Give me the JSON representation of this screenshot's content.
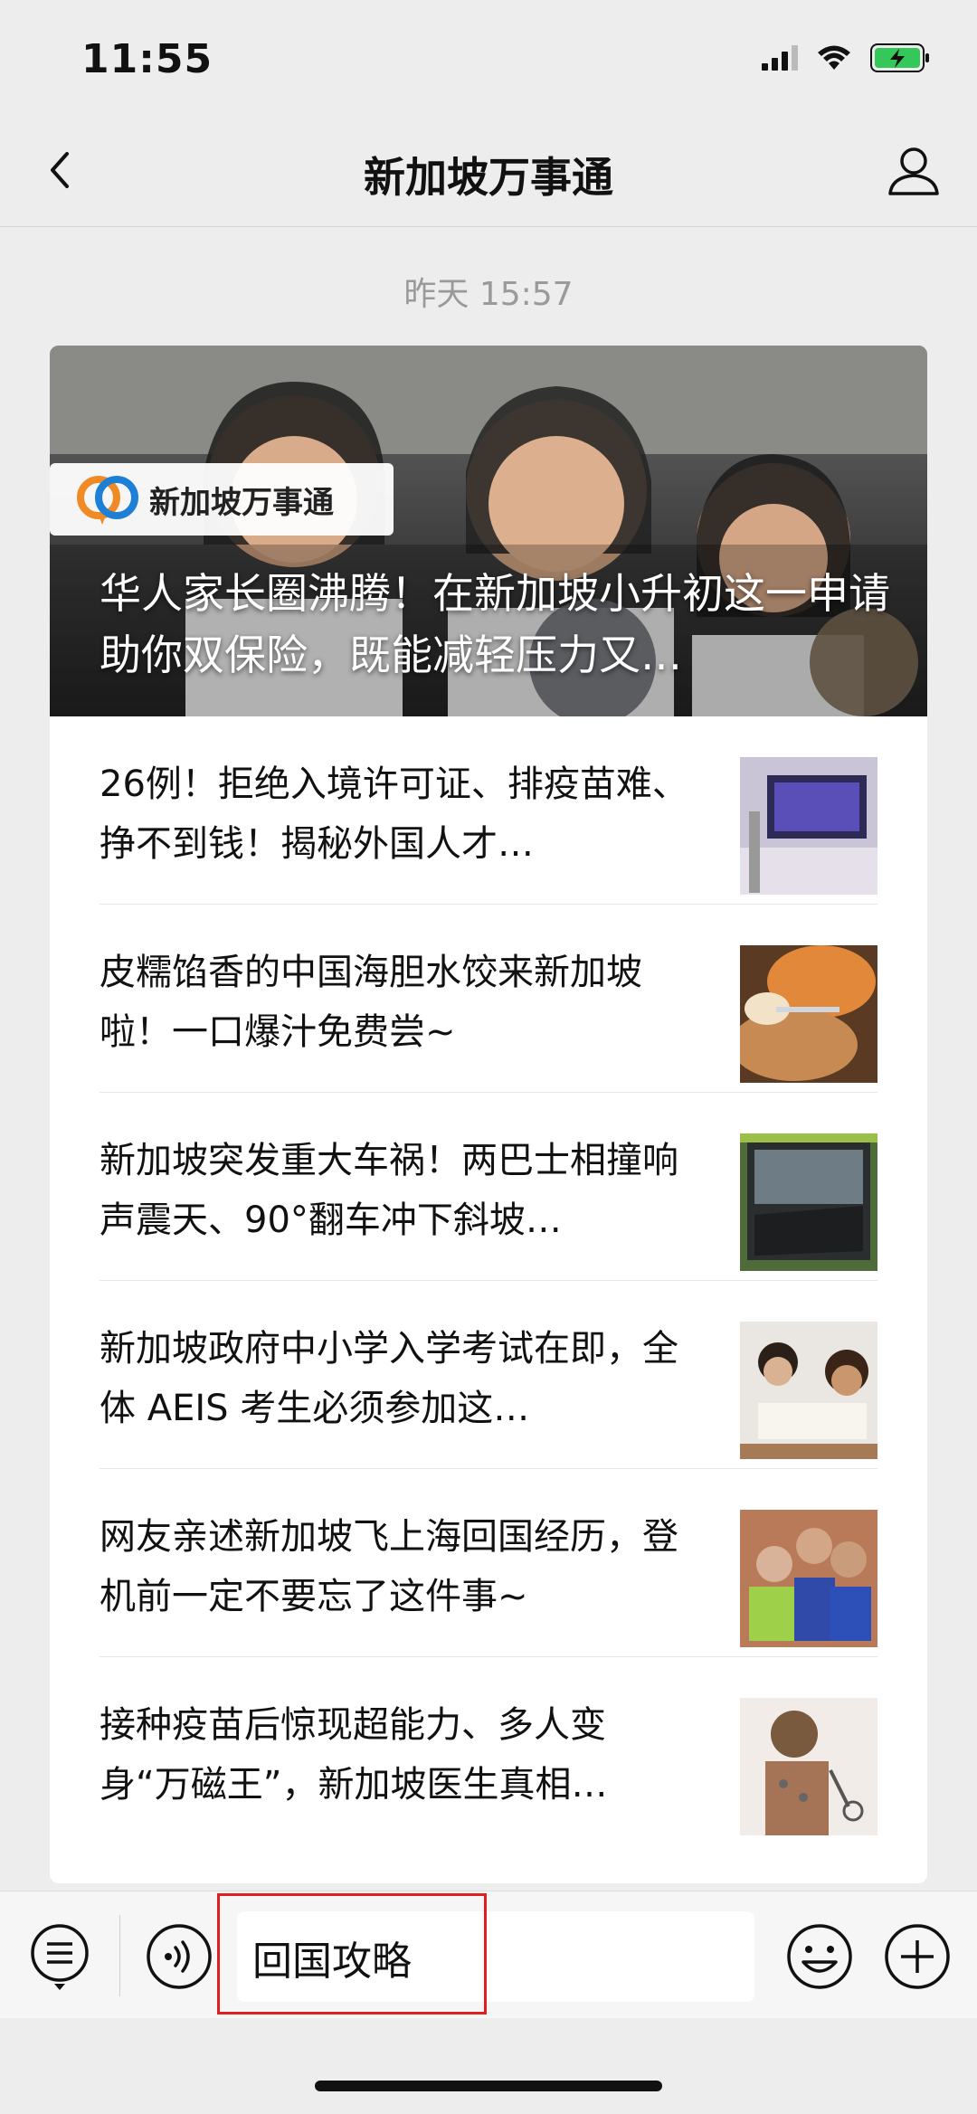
{
  "status_bar": {
    "time": "11:55",
    "icons": [
      "signal-icon",
      "wifi-icon",
      "battery-charging-icon"
    ],
    "battery_color": "#34c759"
  },
  "nav": {
    "title": "新加坡万事通",
    "back_icon": "chevron-left-icon",
    "profile_icon": "person-icon"
  },
  "timestamp": "昨天 15:57",
  "hero": {
    "brand_name": "新加坡万事通",
    "title": "华人家长圈沸腾！在新加坡小升初这一申请助你双保险，既能减轻压力又…"
  },
  "articles": [
    {
      "title": "26例！拒绝入境许可证、排疫苗难、挣不到钱！揭秘外国人才…",
      "thumb": "monitor-photo"
    },
    {
      "title": "皮糯馅香的中国海胆水饺来新加坡啦！一口爆汁免费尝~",
      "thumb": "dumpling-photo"
    },
    {
      "title": "新加坡突发重大车祸！两巴士相撞响声震天、90°翻车冲下斜坡…",
      "thumb": "bus-photo"
    },
    {
      "title": "新加坡政府中小学入学考试在即，全体 AEIS 考生必须参加这…",
      "thumb": "study-photo"
    },
    {
      "title": "网友亲述新加坡飞上海回国经历，登机前一定不要忘了这件事~",
      "thumb": "family-photo"
    },
    {
      "title": "接种疫苗后惊现超能力、多人变身“万磁王”，新加坡医生真相…",
      "thumb": "magnet-photo"
    }
  ],
  "input_bar": {
    "quick_reply": "回国攻略",
    "menu_icon": "menu-list-icon",
    "voice_icon": "voice-icon",
    "emoji_icon": "emoji-icon",
    "plus_icon": "plus-icon",
    "highlight_color": "#e02020"
  }
}
